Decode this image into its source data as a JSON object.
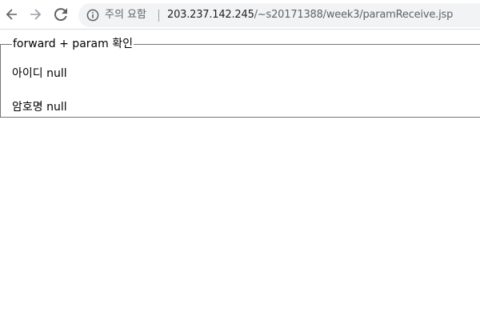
{
  "browser": {
    "security_label": "주의 요함",
    "url_host": "203.237.142.245",
    "url_path": "/~s20171388/week3/paramReceive.jsp",
    "icons": {
      "back": "arrow-left-icon",
      "forward": "arrow-right-icon",
      "reload": "reload-icon",
      "info": "info-circle-icon"
    }
  },
  "page": {
    "legend": "forward + param 확인",
    "id_label": "아이디",
    "id_value": "null",
    "pw_label": "암호명",
    "pw_value": "null"
  },
  "colors": {
    "toolbar_bg": "#ffffff",
    "omnibox_bg": "#f1f3f4",
    "icon_color": "#5f6368",
    "disabled_icon_color": "#9aa0a6"
  }
}
